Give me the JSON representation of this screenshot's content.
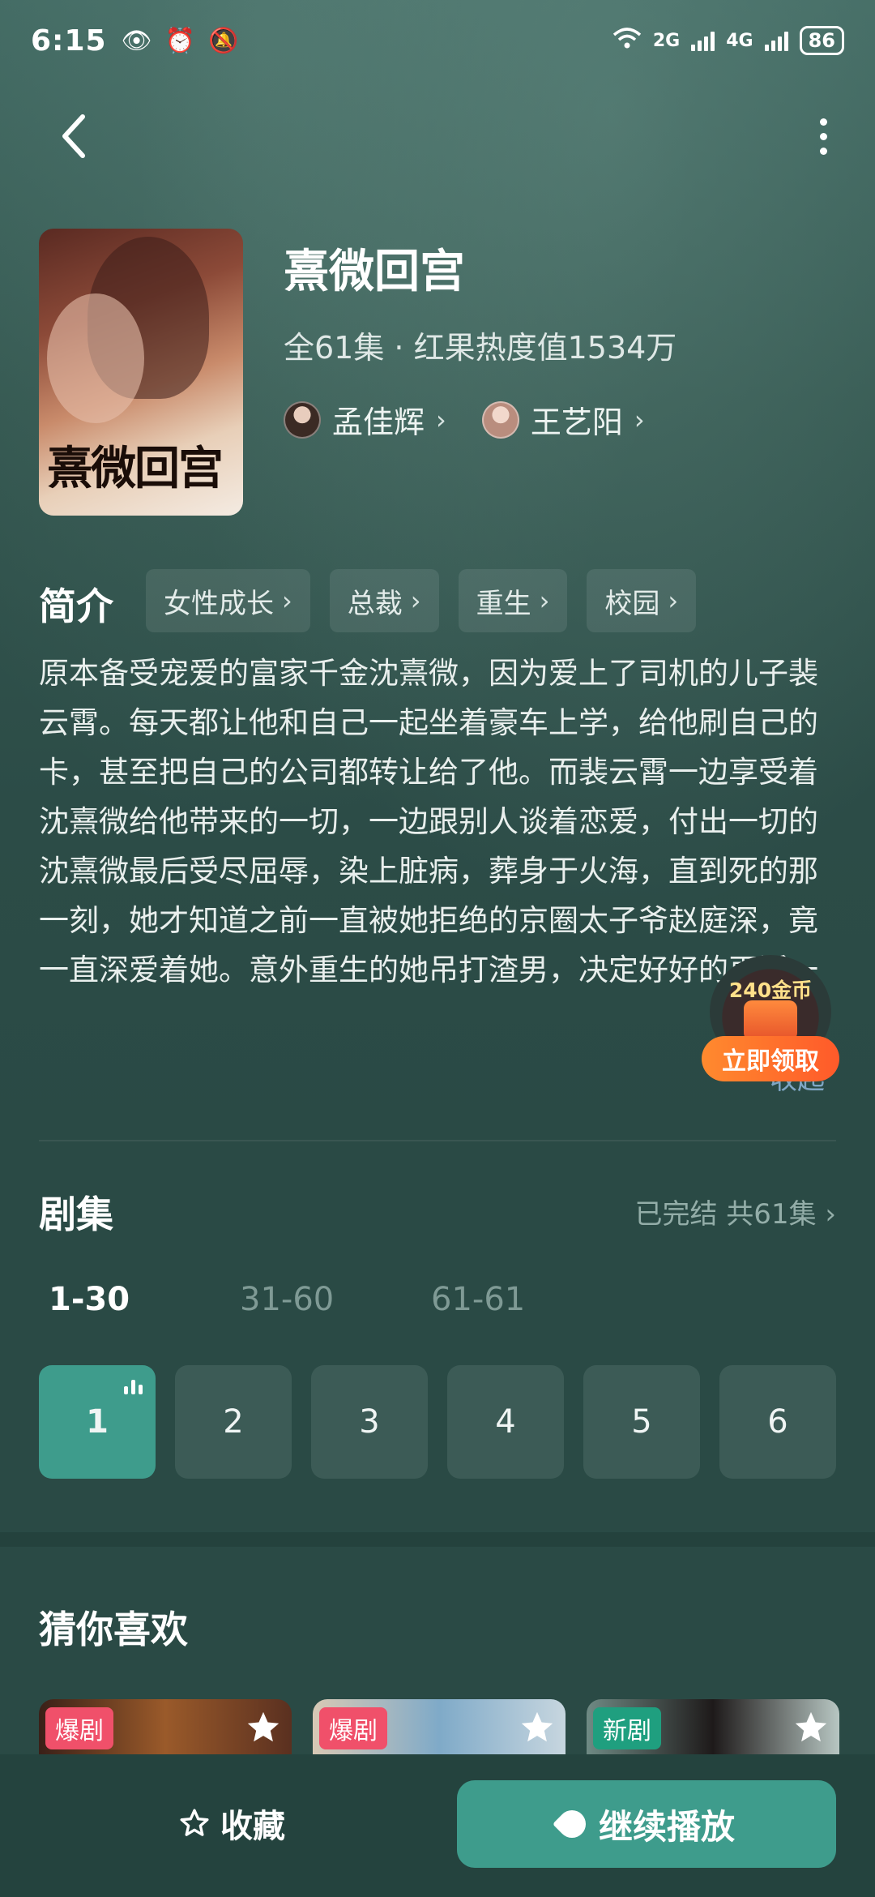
{
  "status": {
    "time": "6:15",
    "battery": "86",
    "net1": "2G",
    "net2": "4G"
  },
  "drama": {
    "title": "熹微回宫",
    "poster_title": "熹微回宫",
    "meta": "全61集 · 红果热度值1534万",
    "cast": [
      {
        "name": "孟佳辉"
      },
      {
        "name": "王艺阳"
      }
    ]
  },
  "synopsis": {
    "label": "简介",
    "tags": [
      "女性成长",
      "总裁",
      "重生",
      "校园"
    ],
    "text": "原本备受宠爱的富家千金沈熹微，因为爱上了司机的儿子裴云霄。每天都让他和自己一起坐着豪车上学，给他刷自己的卡，甚至把自己的公司都转让给了他。而裴云霄一边享受着沈熹微给他带来的一切，一边跟别人谈着恋爱，付出一切的沈熹微最后受尽屈辱，染上脏病，葬身于火海，直到死的那一刻，她才知道之前一直被她拒绝的京圈太子爷赵庭深，竟一直深爱着她。意外重生的她吊打渣男，决定好好的再活一",
    "collapse": "收起"
  },
  "coin": {
    "amount": "240金币",
    "button": "立即领取"
  },
  "episodes": {
    "label": "剧集",
    "status": "已完结 共61集",
    "ranges": [
      "1-30",
      "31-60",
      "61-61"
    ],
    "items": [
      "1",
      "2",
      "3",
      "4",
      "5",
      "6"
    ]
  },
  "recommend": {
    "label": "猜你喜欢",
    "items": [
      {
        "badge": "爆剧"
      },
      {
        "badge": "爆剧"
      },
      {
        "badge": "新剧"
      }
    ]
  },
  "bottom": {
    "favorite": "收藏",
    "play": "继续播放"
  }
}
